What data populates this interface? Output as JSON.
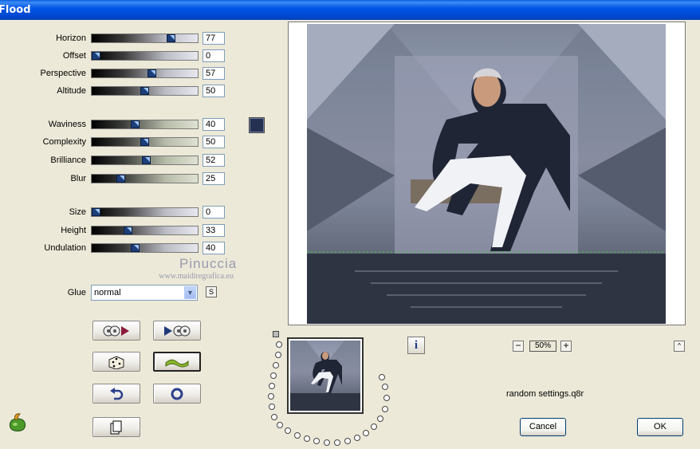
{
  "window": {
    "title": "Flood"
  },
  "sliders_group1": [
    {
      "label": "Horizon",
      "value": "77",
      "pct": 0.77
    },
    {
      "label": "Offset",
      "value": "0",
      "pct": 0.0
    },
    {
      "label": "Perspective",
      "value": "57",
      "pct": 0.57
    },
    {
      "label": "Altitude",
      "value": "50",
      "pct": 0.5
    }
  ],
  "sliders_group2": [
    {
      "label": "Waviness",
      "value": "40",
      "pct": 0.4
    },
    {
      "label": "Complexity",
      "value": "50",
      "pct": 0.5
    },
    {
      "label": "Brilliance",
      "value": "52",
      "pct": 0.52
    },
    {
      "label": "Blur",
      "value": "25",
      "pct": 0.25
    }
  ],
  "sliders_group3": [
    {
      "label": "Size",
      "value": "0",
      "pct": 0.0
    },
    {
      "label": "Height",
      "value": "33",
      "pct": 0.33
    },
    {
      "label": "Undulation",
      "value": "40",
      "pct": 0.4
    }
  ],
  "color": {
    "swatch": "#253150"
  },
  "watermark": {
    "line1": "Pinuccia",
    "line2": "www.maidiregrafica.eu"
  },
  "glue": {
    "label": "Glue",
    "value": "normal",
    "extra_button": "S"
  },
  "toolbar": {
    "icons": [
      "load-settings-icon",
      "save-settings-icon",
      "random-dice-icon",
      "wave-preset-icon",
      "undo-icon",
      "reset-icon",
      "copy-icon"
    ]
  },
  "preview": {
    "zoom": "50%",
    "minus": "−",
    "plus": "+",
    "up": "^",
    "info": "i"
  },
  "status": {
    "text": "random settings.q8r"
  },
  "buttons": {
    "cancel": "Cancel",
    "ok": "OK"
  }
}
